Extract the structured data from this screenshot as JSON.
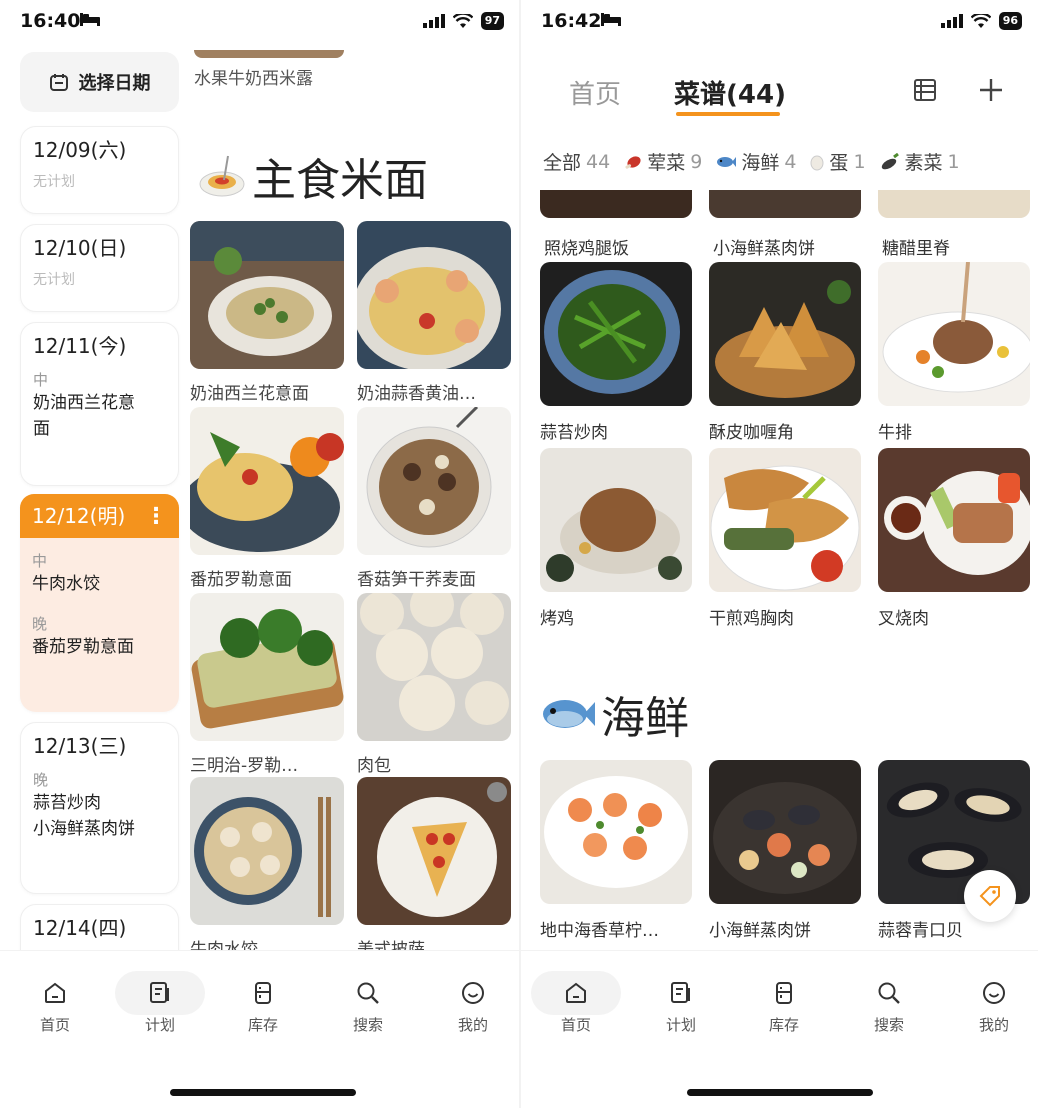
{
  "left": {
    "status": {
      "time": "16:40",
      "battery": "97"
    },
    "date_picker_label": "选择日期",
    "days": [
      {
        "date": "12/09(六)",
        "empty": "无计划"
      },
      {
        "date": "12/10(日)",
        "empty": "无计划"
      },
      {
        "date": "12/11(今)",
        "meal": "中",
        "dishes": [
          "奶油西兰花意",
          "面"
        ]
      },
      {
        "date": "12/12(明)",
        "meals": [
          {
            "meal": "中",
            "dish": "牛肉水饺"
          },
          {
            "meal": "晚",
            "dish": "番茄罗勒意面"
          }
        ]
      },
      {
        "date": "12/13(三)",
        "meal": "晚",
        "dishes": [
          "蒜苔炒肉",
          "小海鲜蒸肉饼"
        ]
      },
      {
        "date": "12/14(四)"
      }
    ],
    "clipped_label": "水果牛奶西米露",
    "section_title": "主食米面",
    "grid": [
      "奶油西兰花意面",
      "奶油蒜香黄油…",
      "番茄罗勒意面",
      "香菇笋干荞麦面",
      "三明治-罗勒…",
      "肉包",
      "牛肉水饺",
      "美式披萨"
    ]
  },
  "right": {
    "status": {
      "time": "16:42",
      "battery": "96"
    },
    "tabs": {
      "home": "首页",
      "recipes": "菜谱(44)"
    },
    "chips": [
      {
        "label": "全部",
        "count": "44"
      },
      {
        "label": "荤菜",
        "count": "9"
      },
      {
        "label": "海鲜",
        "count": "4"
      },
      {
        "label": "蛋",
        "count": "1"
      },
      {
        "label": "素菜",
        "count": "1"
      }
    ],
    "top_row": [
      "照烧鸡腿饭",
      "小海鲜蒸肉饼",
      "糖醋里脊"
    ],
    "grid": [
      "蒜苔炒肉",
      "酥皮咖喱角",
      "牛排",
      "烤鸡",
      "干煎鸡胸肉",
      "叉烧肉"
    ],
    "section_title": "海鲜",
    "seafood": [
      "地中海香草柠…",
      "小海鲜蒸肉饼",
      "蒜蓉青口贝"
    ]
  },
  "nav": [
    "首页",
    "计划",
    "库存",
    "搜索",
    "我的"
  ],
  "colors": {
    "accent": "#f4931d",
    "today_bg": "#fdece2"
  }
}
